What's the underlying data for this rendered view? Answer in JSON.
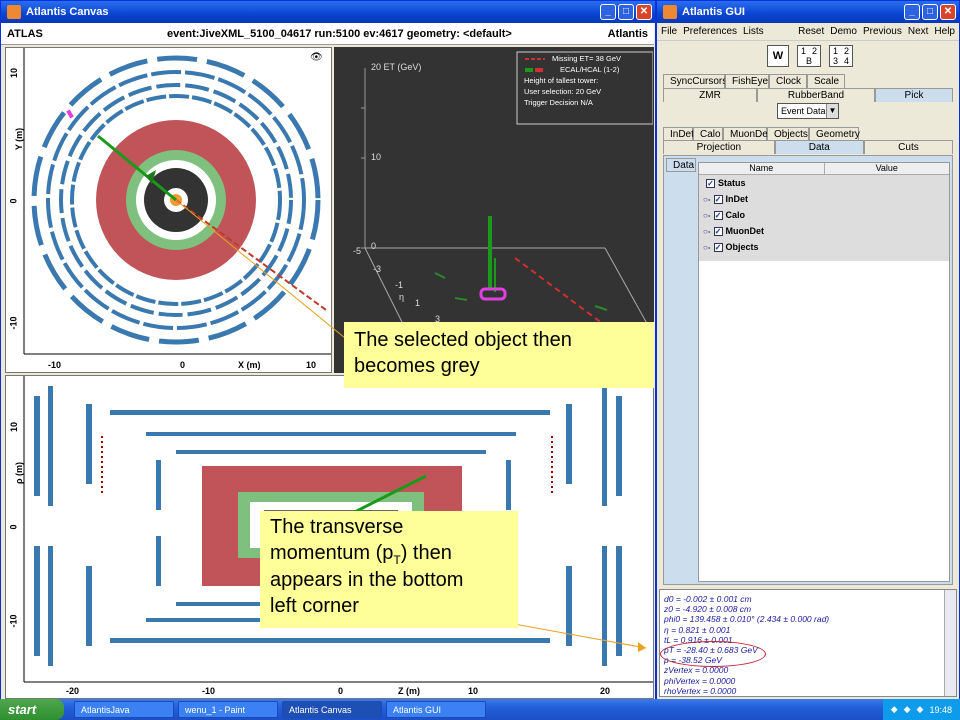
{
  "canvas_window": {
    "title": "Atlantis Canvas",
    "header_left": "ATLAS",
    "header_center": "event:JiveXML_5100_04617 run:5100 ev:4617  geometry: <default>",
    "header_right": "Atlantis"
  },
  "xy_view": {
    "y_axis_title": "Y (m)",
    "x_axis_title": "X (m)",
    "y_ticks": [
      "10",
      "0",
      "-10"
    ],
    "x_ticks": [
      "-10",
      "0",
      "10"
    ]
  },
  "lego_view": {
    "z_title": "20 ET (GeV)",
    "z_ticks": [
      "10",
      "0"
    ],
    "eta_label": "η",
    "legend_line1": "Missing ET= 38 GeV",
    "legend_line2": "ECAL/HCAL (1-2)",
    "legend_line3": "Height of tallest tower:",
    "legend_line4": "User selection: 20 GeV",
    "legend_line5": "Trigger Decision N/A",
    "ticks": [
      "-5",
      "-3",
      "-1",
      "1",
      "3"
    ]
  },
  "rz_view": {
    "y_axis_title": "ρ (m)",
    "x_axis_title": "Z (m)",
    "y_ticks": [
      "10",
      "0",
      "-10"
    ],
    "x_ticks": [
      "-20",
      "-10",
      "0",
      "10",
      "20"
    ]
  },
  "callouts": {
    "grey": "The selected object then becomes grey",
    "pt_line1": "The transverse",
    "pt_line2a": "momentum (p",
    "pt_line2sub": "T",
    "pt_line2b": ") then",
    "pt_line3": "appears in the bottom",
    "pt_line4": "left corner"
  },
  "gui_window": {
    "title": "Atlantis GUI",
    "menu": [
      "File",
      "Preferences",
      "Lists"
    ],
    "menu_right": [
      "Reset",
      "Demo",
      "Previous",
      "Next",
      "Help"
    ],
    "w_button": "W",
    "layout_a": [
      "1",
      "2",
      "B"
    ],
    "layout_b": [
      "1",
      "2",
      "3",
      "4"
    ],
    "tabs_row1": [
      "SyncCursors",
      "FishEye",
      "Clock",
      "Scale"
    ],
    "tabs_row2": [
      "ZMR",
      "RubberBand",
      "Pick"
    ],
    "event_data_select": "Event Data",
    "tabs_row3": [
      "InDet",
      "Calo",
      "MuonDet",
      "Objects",
      "Geometry"
    ],
    "tabs_row4": [
      "Projection",
      "Data",
      "Cuts"
    ],
    "side_tab": "Data",
    "table_header_name": "Name",
    "table_header_value": "Value",
    "tree": [
      "Status",
      "InDet",
      "Calo",
      "MuonDet",
      "Objects"
    ],
    "output_lines": [
      "d0 = -0.002 ± 0.001 cm",
      "z0 = -4.920 ± 0.008 cm",
      "phi0 = 139.458 ± 0.010° (2.434 ± 0.000 rad)",
      "η = 0.821 ± 0.001",
      "tL = 0.916 ± 0.001",
      "pT = -28.40 ± 0.683 GeV",
      "p = -38.52 GeV",
      "zVertex = 0.0000",
      "phiVertex = 0.0000",
      "rhoVertex = 0.0000"
    ]
  },
  "taskbar": {
    "start": "start",
    "tasks": [
      "AtlantisJava",
      "wenu_1 - Paint",
      "Atlantis Canvas",
      "Atlantis GUI"
    ],
    "clock": "19:48"
  }
}
